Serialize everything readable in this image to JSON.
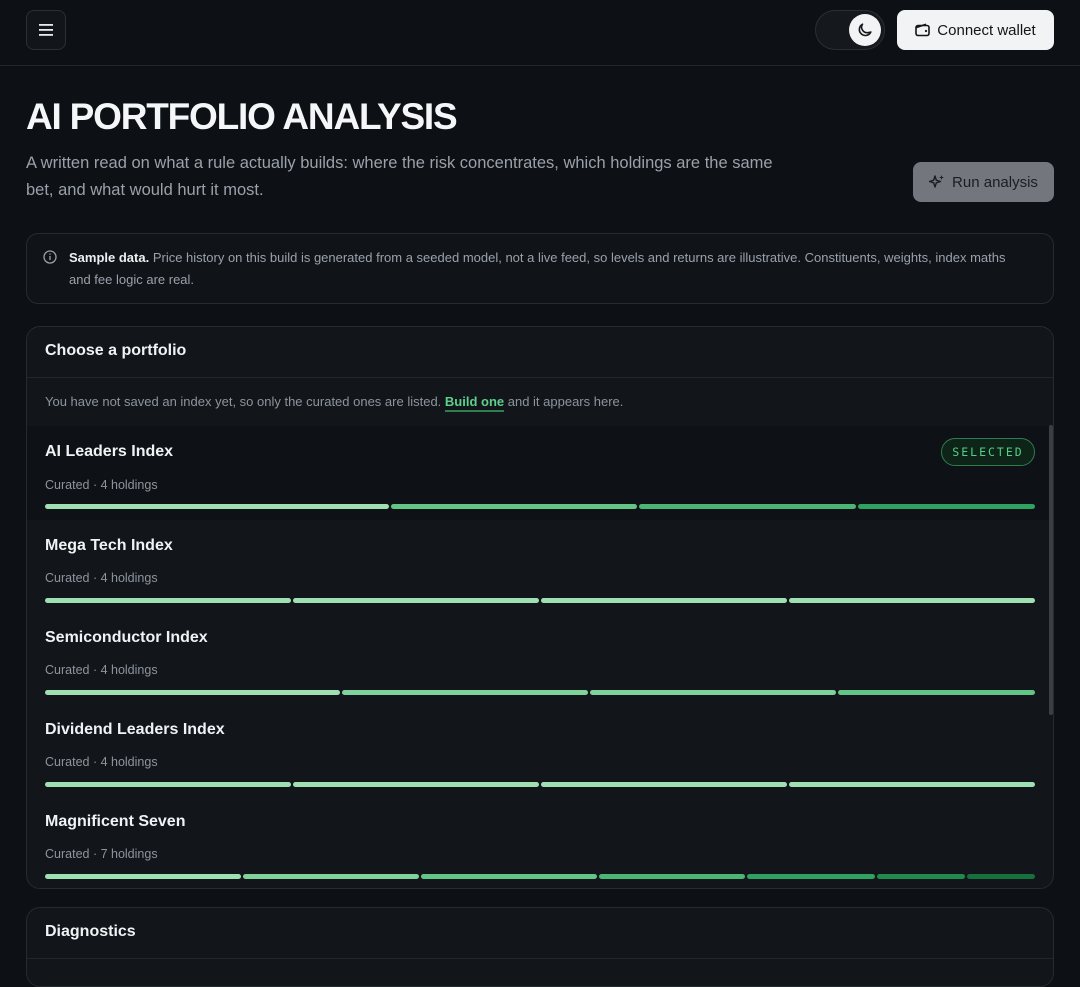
{
  "header": {
    "menu_icon": "menu-icon",
    "theme_icon": "moon-icon",
    "connect_label": "Connect wallet",
    "connect_icon": "wallet-icon"
  },
  "page": {
    "title": "AI PORTFOLIO ANALYSIS",
    "subtitle": "A written read on what a rule actually builds: where the risk concentrates, which holdings are the same bet, and what would hurt it most.",
    "run_label": "Run analysis",
    "run_icon": "sparkles-icon"
  },
  "notice": {
    "icon": "info-icon",
    "bold": "Sample data.",
    "text": " Price history on this build is generated from a seeded model, not a live feed, so levels and returns are illustrative. Constituents, weights, index maths and fee logic are real."
  },
  "chooser": {
    "title": "Choose a portfolio",
    "note_before": "You have not saved an index yet, so only the curated ones are listed. ",
    "note_link": "Build one",
    "note_after": " and it appears here.",
    "selected_badge": "SELECTED",
    "items": [
      {
        "name": "AI Leaders Index",
        "meta": "Curated · 4 holdings",
        "selected": true,
        "weights": [
          35,
          25,
          22,
          18
        ]
      },
      {
        "name": "Mega Tech Index",
        "meta": "Curated · 4 holdings",
        "selected": false,
        "weights": [
          25,
          25,
          25,
          25
        ]
      },
      {
        "name": "Semiconductor Index",
        "meta": "Curated · 4 holdings",
        "selected": false,
        "weights": [
          30,
          25,
          25,
          20
        ]
      },
      {
        "name": "Dividend Leaders Index",
        "meta": "Curated · 4 holdings",
        "selected": false,
        "weights": [
          25,
          25,
          25,
          25
        ]
      },
      {
        "name": "Magnificent Seven",
        "meta": "Curated · 7 holdings",
        "selected": false,
        "weights": [
          20,
          18,
          18,
          15,
          13,
          9,
          7
        ]
      }
    ],
    "segment_colors": [
      "#9fe0b3",
      "#7fd29c",
      "#63c487",
      "#4bb574",
      "#2fa160",
      "#208a4e",
      "#176f3e"
    ]
  },
  "diagnostics": {
    "title": "Diagnostics"
  }
}
